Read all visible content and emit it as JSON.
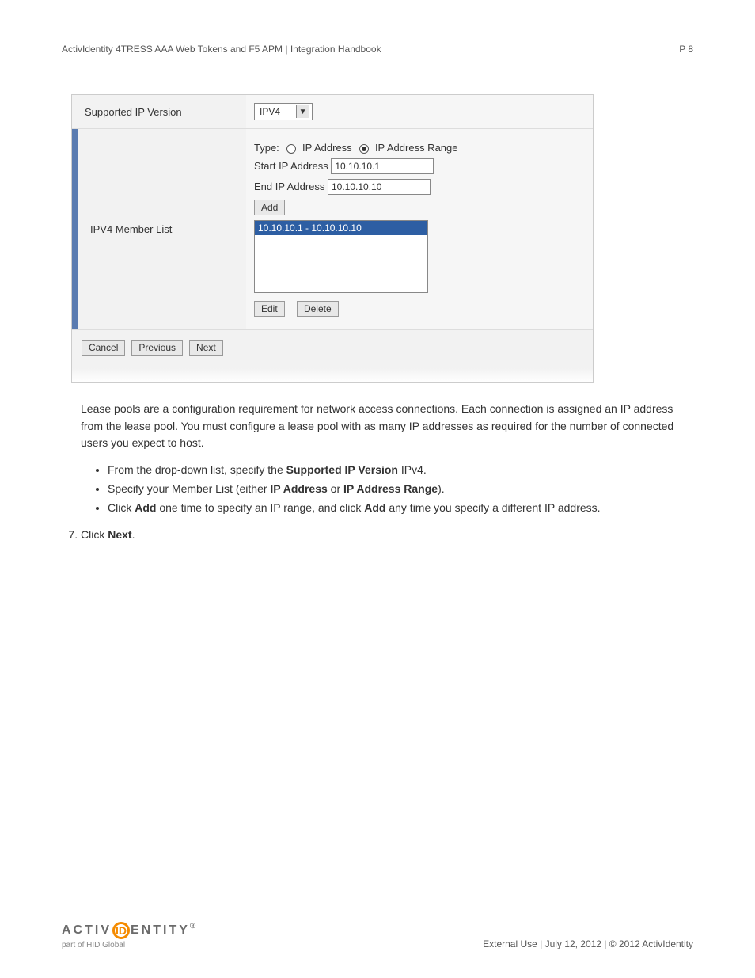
{
  "header": {
    "title": "ActivIdentity 4TRESS AAA Web Tokens and F5 APM | Integration Handbook",
    "page": "P 8"
  },
  "form": {
    "row1_label": "Supported IP Version",
    "row1_value": "IPV4",
    "row2_label": "IPV4 Member List",
    "type_label": "Type:",
    "type_opt1": "IP Address",
    "type_opt2": "IP Address Range",
    "start_label": "Start IP Address",
    "start_value": "10.10.10.1",
    "end_label": "End IP Address",
    "end_value": "10.10.10.10",
    "add_btn": "Add",
    "list_item": "10.10.10.1 - 10.10.10.10",
    "edit_btn": "Edit",
    "delete_btn": "Delete",
    "cancel_btn": "Cancel",
    "previous_btn": "Previous",
    "next_btn": "Next"
  },
  "para": "Lease pools are a configuration requirement for network access connections. Each connection is assigned an IP address from the lease pool. You must configure a lease pool with as many IP addresses as required for the number of connected users you expect to host.",
  "bullets": {
    "b1_pre": "From the drop-down list, specify the ",
    "b1_bold": "Supported IP Version",
    "b1_post": " IPv4.",
    "b2_pre": "Specify your Member List (either ",
    "b2_bold1": "IP Address",
    "b2_mid": " or ",
    "b2_bold2": "IP Address Range",
    "b2_post": ").",
    "b3_pre": "Click ",
    "b3_bold1": "Add",
    "b3_mid": " one time to specify an IP range, and click ",
    "b3_bold2": "Add",
    "b3_post": " any time you specify a different IP address."
  },
  "step7_pre": "Click ",
  "step7_bold": "Next",
  "step7_post": ".",
  "footer": {
    "logo_left": "ACTIV",
    "logo_mid": "ID",
    "logo_right": "ENTITY",
    "logo_sub": "part of HID Global",
    "right": "External Use | July 12, 2012 | © 2012 ActivIdentity"
  }
}
